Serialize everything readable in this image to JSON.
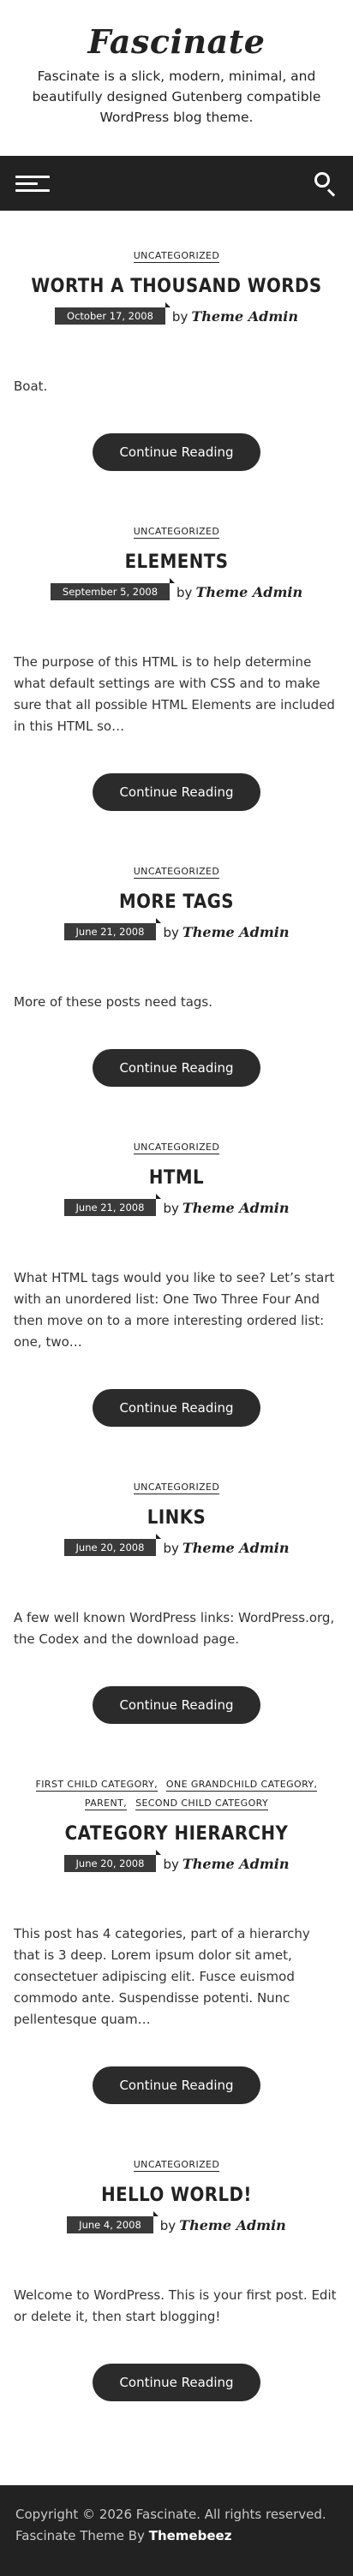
{
  "site": {
    "title": "Fascinate",
    "description": "Fascinate is a slick, modern, minimal, and beautifully designed Gutenberg compatible WordPress blog theme."
  },
  "nav": {
    "menu_icon": "hamburger-menu-icon",
    "search_icon": "search-icon"
  },
  "colors": {
    "header_bg": "#222222",
    "button_bg": "#2b2b2b",
    "date_bg": "#3a3a3a"
  },
  "posts": [
    {
      "categories": [
        "UNCATEGORIZED"
      ],
      "title": "WORTH A THOUSAND WORDS",
      "date": "October 17, 2008",
      "by": "by",
      "author": "Theme Admin",
      "excerpt": "Boat.",
      "button": "Continue Reading"
    },
    {
      "categories": [
        "UNCATEGORIZED"
      ],
      "title": "ELEMENTS",
      "date": "September 5, 2008",
      "by": "by",
      "author": "Theme Admin",
      "excerpt": "The purpose of this HTML is to help determine what default settings are with CSS and to make sure that all possible HTML Elements are included in this HTML so…",
      "button": "Continue Reading"
    },
    {
      "categories": [
        "UNCATEGORIZED"
      ],
      "title": "MORE TAGS",
      "date": "June 21, 2008",
      "by": "by",
      "author": "Theme Admin",
      "excerpt": "More of these posts need tags.",
      "button": "Continue Reading"
    },
    {
      "categories": [
        "UNCATEGORIZED"
      ],
      "title": "HTML",
      "date": "June 21, 2008",
      "by": "by",
      "author": "Theme Admin",
      "excerpt": "What HTML tags would you like to see? Let’s start with an unordered list: One Two Three Four And then move on to a more interesting ordered list: one, two…",
      "button": "Continue Reading"
    },
    {
      "categories": [
        "UNCATEGORIZED"
      ],
      "title": "LINKS",
      "date": "June 20, 2008",
      "by": "by",
      "author": "Theme Admin",
      "excerpt": "A few well known WordPress links: WordPress.org, the Codex and the download page.",
      "button": "Continue Reading"
    },
    {
      "categories": [
        "FIRST CHILD CATEGORY,",
        "ONE GRANDCHILD CATEGORY,",
        "PARENT,",
        "SECOND CHILD CATEGORY"
      ],
      "title": "CATEGORY HIERARCHY",
      "date": "June 20, 2008",
      "by": "by",
      "author": "Theme Admin",
      "excerpt": "This post has 4 categories, part of a hierarchy that is 3 deep. Lorem ipsum dolor sit amet, consectetuer adipiscing elit. Fusce euismod commodo ante. Suspendisse potenti. Nunc pellentesque quam…",
      "button": "Continue Reading"
    },
    {
      "categories": [
        "UNCATEGORIZED"
      ],
      "title": "HELLO WORLD!",
      "date": "June 4, 2008",
      "by": "by",
      "author": "Theme Admin",
      "excerpt": "Welcome to WordPress. This is your first post. Edit or delete it, then start blogging!",
      "button": "Continue Reading"
    }
  ],
  "footer": {
    "copyright": "Copyright © 2026 Fascinate. All rights reserved.",
    "credit_prefix": "Fascinate Theme By",
    "credit_link": "Themebeez"
  }
}
